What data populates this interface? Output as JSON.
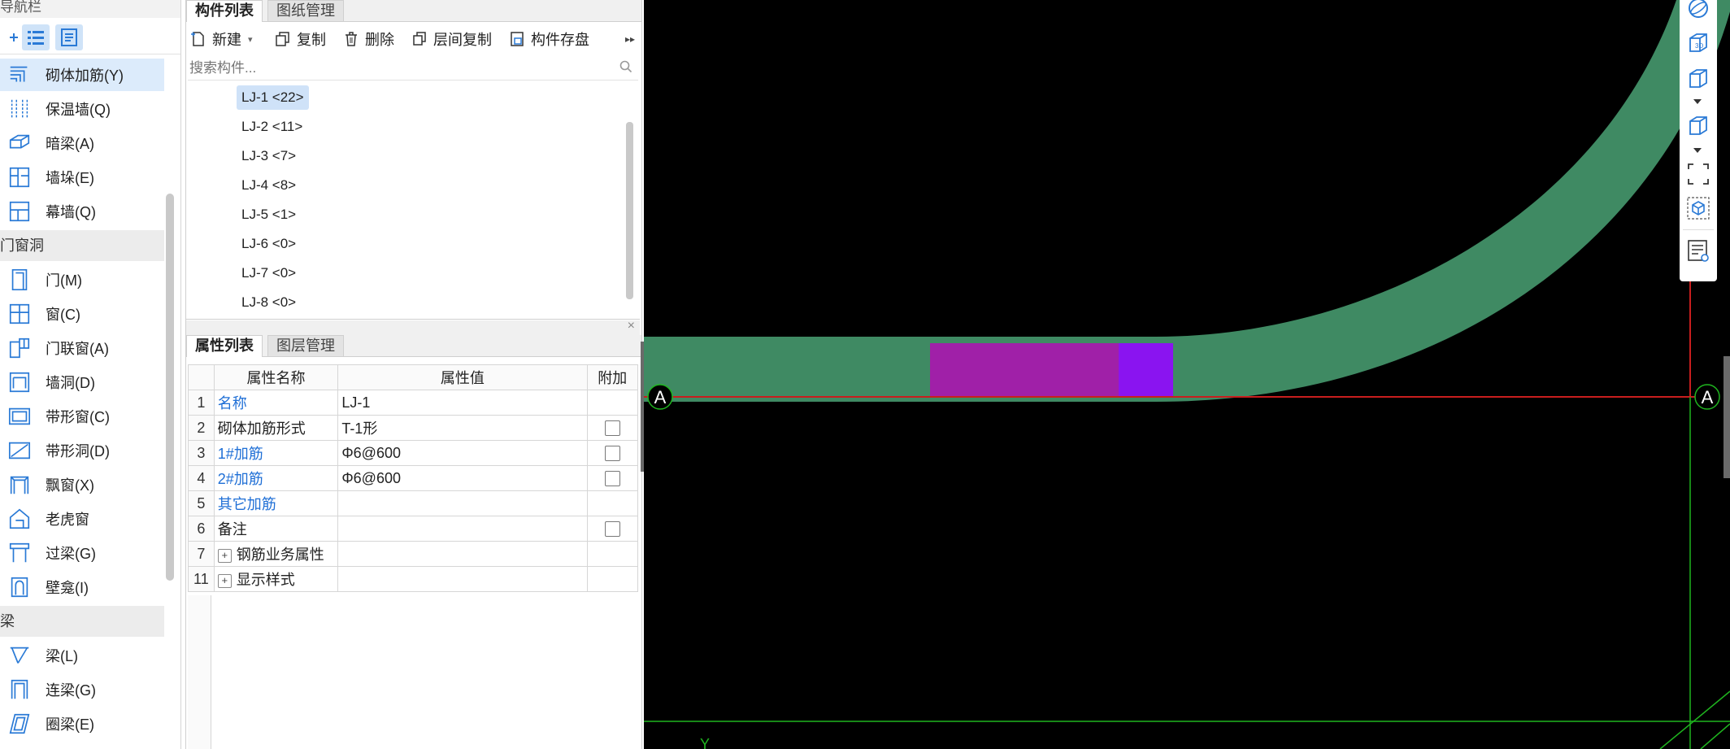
{
  "nav": {
    "title": "导航栏",
    "items_wall": [
      {
        "label": "砌体加筋(Y)",
        "icon": "masonry-reinforcement-icon",
        "selected": true
      },
      {
        "label": "保温墙(Q)",
        "icon": "insulation-wall-icon"
      },
      {
        "label": "暗梁(A)",
        "icon": "hidden-beam-icon"
      },
      {
        "label": "墙垛(E)",
        "icon": "wall-pier-icon"
      },
      {
        "label": "幕墙(Q)",
        "icon": "curtain-wall-icon"
      }
    ],
    "group_openings": "门窗洞",
    "items_openings": [
      {
        "label": "门(M)",
        "icon": "door-icon"
      },
      {
        "label": "窗(C)",
        "icon": "window-icon"
      },
      {
        "label": "门联窗(A)",
        "icon": "door-window-icon"
      },
      {
        "label": "墙洞(D)",
        "icon": "wall-opening-icon"
      },
      {
        "label": "带形窗(C)",
        "icon": "strip-window-icon"
      },
      {
        "label": "带形洞(D)",
        "icon": "strip-opening-icon"
      },
      {
        "label": "飘窗(X)",
        "icon": "bay-window-icon"
      },
      {
        "label": "老虎窗",
        "icon": "dormer-window-icon"
      },
      {
        "label": "过梁(G)",
        "icon": "lintel-icon"
      },
      {
        "label": "壁龛(I)",
        "icon": "niche-icon"
      }
    ],
    "group_beams": "梁",
    "items_beams": [
      {
        "label": "梁(L)",
        "icon": "beam-icon"
      },
      {
        "label": "连梁(G)",
        "icon": "coupling-beam-icon"
      },
      {
        "label": "圈梁(E)",
        "icon": "ring-beam-icon"
      }
    ]
  },
  "components": {
    "tabs": [
      "构件列表",
      "图纸管理"
    ],
    "toolbar": {
      "new": "新建",
      "copy": "复制",
      "delete": "删除",
      "floor_copy": "层间复制",
      "save": "构件存盘"
    },
    "search_placeholder": "搜索构件...",
    "items": [
      "LJ-1 <22>",
      "LJ-2 <11>",
      "LJ-3 <7>",
      "LJ-4 <8>",
      "LJ-5 <1>",
      "LJ-6 <0>",
      "LJ-7 <0>",
      "LJ-8 <0>"
    ]
  },
  "properties": {
    "tabs": [
      "属性列表",
      "图层管理"
    ],
    "headers": {
      "name": "属性名称",
      "value": "属性值",
      "extra": "附加"
    },
    "rows": [
      {
        "num": "1",
        "name": "名称",
        "value": "LJ-1",
        "blue": true,
        "checkbox": false
      },
      {
        "num": "2",
        "name": "砌体加筋形式",
        "value": "T-1形",
        "blue": false,
        "checkbox": true
      },
      {
        "num": "3",
        "name": "1#加筋",
        "value": "Φ6@600",
        "blue": true,
        "checkbox": true
      },
      {
        "num": "4",
        "name": "2#加筋",
        "value": "Φ6@600",
        "blue": true,
        "checkbox": true
      },
      {
        "num": "5",
        "name": "其它加筋",
        "value": "",
        "blue": true,
        "checkbox": false
      },
      {
        "num": "6",
        "name": "备注",
        "value": "",
        "blue": false,
        "checkbox": true
      },
      {
        "num": "7",
        "name": "钢筋业务属性",
        "value": "",
        "blue": false,
        "checkbox": false,
        "expand": true
      },
      {
        "num": "11",
        "name": "显示样式",
        "value": "",
        "blue": false,
        "checkbox": false,
        "expand": true
      }
    ]
  },
  "canvas": {
    "axis_label_left": "A",
    "axis_label_right": "A",
    "y_axis_label": "Y",
    "colors": {
      "background": "#000000",
      "wall": "#3f8a63",
      "element_magenta": "#a020a8",
      "element_violet": "#8a14f0",
      "axis_red": "#c81e1e",
      "grid_green": "#1fb51f"
    }
  },
  "view_toolbar": [
    "perspective-sphere-icon",
    "3d-view-icon",
    "cube-view-icon",
    "cube-view-alt-icon",
    "fullscreen-icon",
    "component-view-icon",
    "layer-settings-icon"
  ]
}
